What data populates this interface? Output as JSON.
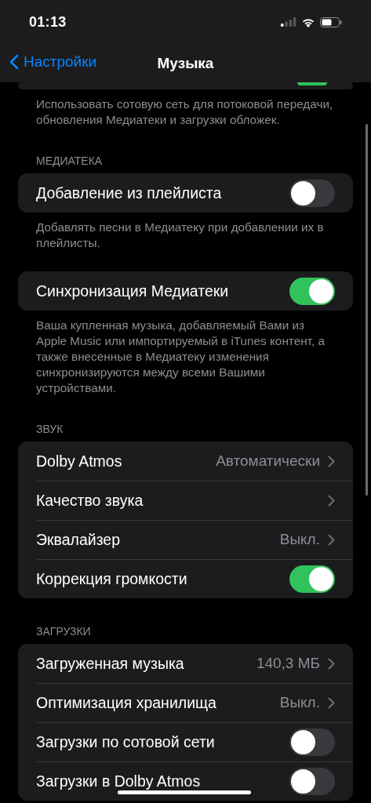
{
  "status_bar": {
    "time": "01:13"
  },
  "nav": {
    "back": "Настройки",
    "title": "Музыка"
  },
  "sections": [
    {
      "rows": [
        {
          "kind": "toggle",
          "on": true
        }
      ],
      "footer": "Использовать сотовую сеть для потоковой передачи, обновления Медиатеки и загрузки обложек."
    },
    {
      "header": "МЕДИАТЕКА",
      "rows": [
        {
          "kind": "toggle",
          "label": "Добавление из плейлиста",
          "on": false
        }
      ],
      "footer": "Добавлять песни в Медиатеку при добавлении их в плейлисты."
    },
    {
      "rows": [
        {
          "kind": "toggle",
          "label": "Синхронизация Медиатеки",
          "on": true
        }
      ],
      "footer": "Ваша купленная музыка, добавляемый Вами из Apple Music или импортируемый в iTunes контент, а также внесенные в Медиатеку изменения синхронизируются между всеми Вашими устройствами."
    },
    {
      "header": "ЗВУК",
      "rows": [
        {
          "kind": "link",
          "label": "Dolby Atmos",
          "value": "Автоматически"
        },
        {
          "kind": "link",
          "label": "Качество звука"
        },
        {
          "kind": "link",
          "label": "Эквалайзер",
          "value": "Выкл."
        },
        {
          "kind": "toggle",
          "label": "Коррекция громкости",
          "on": true
        }
      ]
    },
    {
      "header": "ЗАГРУЗКИ",
      "rows": [
        {
          "kind": "link",
          "label": "Загруженная музыка",
          "value": "140,3 МБ"
        },
        {
          "kind": "link",
          "label": "Оптимизация хранилища",
          "value": "Выкл."
        },
        {
          "kind": "toggle",
          "label": "Загрузки по сотовой сети",
          "on": false
        },
        {
          "kind": "toggle",
          "label": "Загрузки в Dolby Atmos",
          "on": false
        }
      ]
    }
  ]
}
